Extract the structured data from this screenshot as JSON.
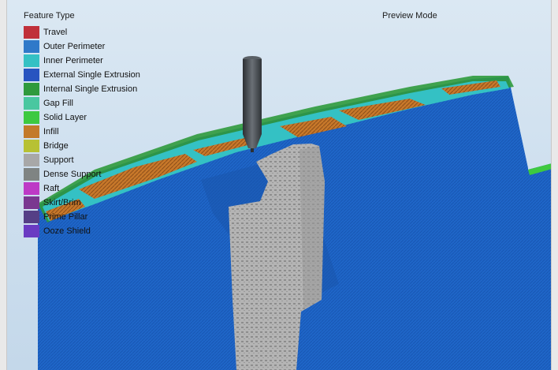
{
  "legend": {
    "title": "Feature Type",
    "items": [
      {
        "label": "Travel",
        "color": "#c0303a"
      },
      {
        "label": "Outer Perimeter",
        "color": "#2f79c9"
      },
      {
        "label": "Inner Perimeter",
        "color": "#34c1c4"
      },
      {
        "label": "External Single Extrusion",
        "color": "#2854c0"
      },
      {
        "label": "Internal Single Extrusion",
        "color": "#2f9a3c"
      },
      {
        "label": "Gap Fill",
        "color": "#49c7a0"
      },
      {
        "label": "Solid Layer",
        "color": "#3dc940"
      },
      {
        "label": "Infill",
        "color": "#c37a2a"
      },
      {
        "label": "Bridge",
        "color": "#b7c134"
      },
      {
        "label": "Support",
        "color": "#a8a8a8"
      },
      {
        "label": "Dense Support",
        "color": "#7f8483"
      },
      {
        "label": "Raft",
        "color": "#bd3ac6"
      },
      {
        "label": "Skirt/Brim",
        "color": "#7a3890"
      },
      {
        "label": "Prime Pillar",
        "color": "#553f86"
      },
      {
        "label": "Ooze Shield",
        "color": "#6a3bc2"
      }
    ]
  },
  "view": {
    "mode": "Preview Mode"
  },
  "colors": {
    "part_blue": "#1f66c8",
    "part_blue_dark": "#1a56ad",
    "support_gray": "#a9a9a9",
    "nozzle": "#4a4f54"
  }
}
